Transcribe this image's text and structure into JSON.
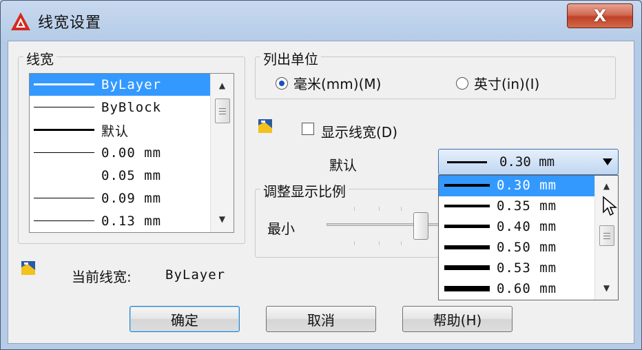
{
  "window": {
    "title": "线宽设置",
    "close_label": "X"
  },
  "lineweights": {
    "group_label": "线宽",
    "items": [
      {
        "label": "ByLayer",
        "selected": true
      },
      {
        "label": "ByBlock",
        "selected": false
      },
      {
        "label": "默认",
        "selected": false
      },
      {
        "label": "0.00 mm",
        "selected": false
      },
      {
        "label": "0.05 mm",
        "selected": false
      },
      {
        "label": "0.09 mm",
        "selected": false
      },
      {
        "label": "0.13 mm",
        "selected": false
      }
    ]
  },
  "units": {
    "group_label": "列出单位",
    "options": [
      {
        "label": "毫米(mm)(M)",
        "selected": true
      },
      {
        "label": "英寸(in)(I)",
        "selected": false
      }
    ]
  },
  "display": {
    "checkbox_label": "显示线宽(D)",
    "checked": false
  },
  "default": {
    "label": "默认",
    "value": "0.30 mm"
  },
  "dropdown": {
    "items": [
      {
        "label": "0.30 mm",
        "selected": true
      },
      {
        "label": "0.35 mm",
        "selected": false
      },
      {
        "label": "0.40 mm",
        "selected": false
      },
      {
        "label": "0.50 mm",
        "selected": false
      },
      {
        "label": "0.53 mm",
        "selected": false
      },
      {
        "label": "0.60 mm",
        "selected": false
      }
    ]
  },
  "scale": {
    "group_label": "调整显示比例",
    "min_label": "最小"
  },
  "current": {
    "label": "当前线宽:",
    "value": "ByLayer"
  },
  "buttons": {
    "ok": "确定",
    "cancel": "取消",
    "help": "帮助(H)"
  },
  "colors": {
    "selection": "#3399ff",
    "close_button": "#c0412a"
  }
}
